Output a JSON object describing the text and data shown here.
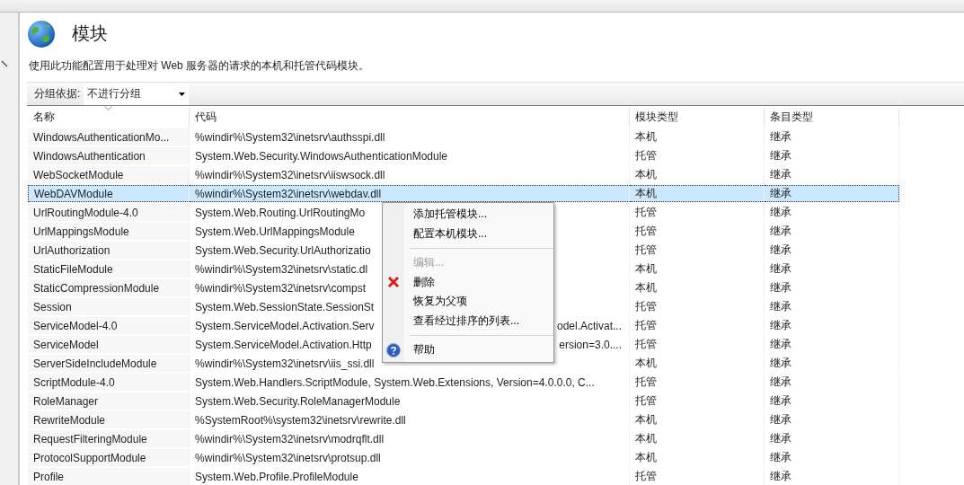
{
  "page": {
    "title": "模块",
    "description": "使用此功能配置用于处理对 Web 服务器的请求的本机和托管代码模块。"
  },
  "grouping": {
    "label": "分组依据:",
    "value": "不进行分组"
  },
  "table": {
    "columns": [
      "名称",
      "代码",
      "模块类型",
      "条目类型"
    ],
    "rows": [
      {
        "name": "WindowsAuthenticationMo...",
        "code": "%windir%\\System32\\inetsrv\\authsspi.dll",
        "module_type": "本机",
        "entry_type": "继承",
        "selected": false
      },
      {
        "name": "WindowsAuthentication",
        "code": "System.Web.Security.WindowsAuthenticationModule",
        "module_type": "托管",
        "entry_type": "继承",
        "selected": false
      },
      {
        "name": "WebSocketModule",
        "code": "%windir%\\System32\\inetsrv\\iiswsock.dll",
        "module_type": "本机",
        "entry_type": "继承",
        "selected": false
      },
      {
        "name": "WebDAVModule",
        "code": "%windir%\\System32\\inetsrv\\webdav.dll",
        "module_type": "本机",
        "entry_type": "继承",
        "selected": true
      },
      {
        "name": "UrlRoutingModule-4.0",
        "code": "System.Web.Routing.UrlRoutingMo",
        "module_type": "托管",
        "entry_type": "继承",
        "selected": false
      },
      {
        "name": "UrlMappingsModule",
        "code": "System.Web.UrlMappingsModule",
        "module_type": "托管",
        "entry_type": "继承",
        "selected": false
      },
      {
        "name": "UrlAuthorization",
        "code": "System.Web.Security.UrlAuthorizatio",
        "module_type": "托管",
        "entry_type": "继承",
        "selected": false
      },
      {
        "name": "StaticFileModule",
        "code": "%windir%\\System32\\inetsrv\\static.dl",
        "module_type": "本机",
        "entry_type": "继承",
        "selected": false
      },
      {
        "name": "StaticCompressionModule",
        "code": "%windir%\\System32\\inetsrv\\compst",
        "module_type": "本机",
        "entry_type": "继承",
        "selected": false
      },
      {
        "name": "Session",
        "code": "System.Web.SessionState.SessionSt",
        "module_type": "托管",
        "entry_type": "继承",
        "selected": false
      },
      {
        "name": "ServiceModel-4.0",
        "code": "System.ServiceModel.Activation.Serv",
        "code_tail": "odel.Activat...",
        "module_type": "托管",
        "entry_type": "继承",
        "selected": false
      },
      {
        "name": "ServiceModel",
        "code": "System.ServiceModel.Activation.Http",
        "code_tail": "ersion=3.0....",
        "module_type": "托管",
        "entry_type": "继承",
        "selected": false
      },
      {
        "name": "ServerSideIncludeModule",
        "code": "%windir%\\System32\\inetsrv\\iis_ssi.dll",
        "module_type": "本机",
        "entry_type": "继承",
        "selected": false
      },
      {
        "name": "ScriptModule-4.0",
        "code": "System.Web.Handlers.ScriptModule, System.Web.Extensions, Version=4.0.0.0, C...",
        "module_type": "托管",
        "entry_type": "继承",
        "selected": false
      },
      {
        "name": "RoleManager",
        "code": "System.Web.Security.RoleManagerModule",
        "module_type": "托管",
        "entry_type": "继承",
        "selected": false
      },
      {
        "name": "RewriteModule",
        "code": "%SystemRoot%\\system32\\inetsrv\\rewrite.dll",
        "module_type": "本机",
        "entry_type": "继承",
        "selected": false
      },
      {
        "name": "RequestFilteringModule",
        "code": "%windir%\\System32\\inetsrv\\modrqflt.dll",
        "module_type": "本机",
        "entry_type": "继承",
        "selected": false
      },
      {
        "name": "ProtocolSupportModule",
        "code": "%windir%\\System32\\inetsrv\\protsup.dll",
        "module_type": "本机",
        "entry_type": "继承",
        "selected": false
      },
      {
        "name": "Profile",
        "code": "System.Web.Profile.ProfileModule",
        "module_type": "托管",
        "entry_type": "继承",
        "selected": false
      }
    ]
  },
  "context_menu": {
    "items": [
      {
        "kind": "plain",
        "label": "添加托管模块...",
        "disabled": false
      },
      {
        "kind": "plain",
        "label": "配置本机模块...",
        "disabled": false
      },
      {
        "kind": "separator"
      },
      {
        "kind": "plain",
        "label": "编辑...",
        "disabled": true
      },
      {
        "kind": "delete",
        "label": "删除",
        "disabled": false
      },
      {
        "kind": "plain",
        "label": "恢复为父项",
        "disabled": false
      },
      {
        "kind": "plain",
        "label": "查看经过排序的列表...",
        "disabled": false
      },
      {
        "kind": "separator"
      },
      {
        "kind": "help",
        "label": "帮助",
        "disabled": false
      }
    ]
  }
}
